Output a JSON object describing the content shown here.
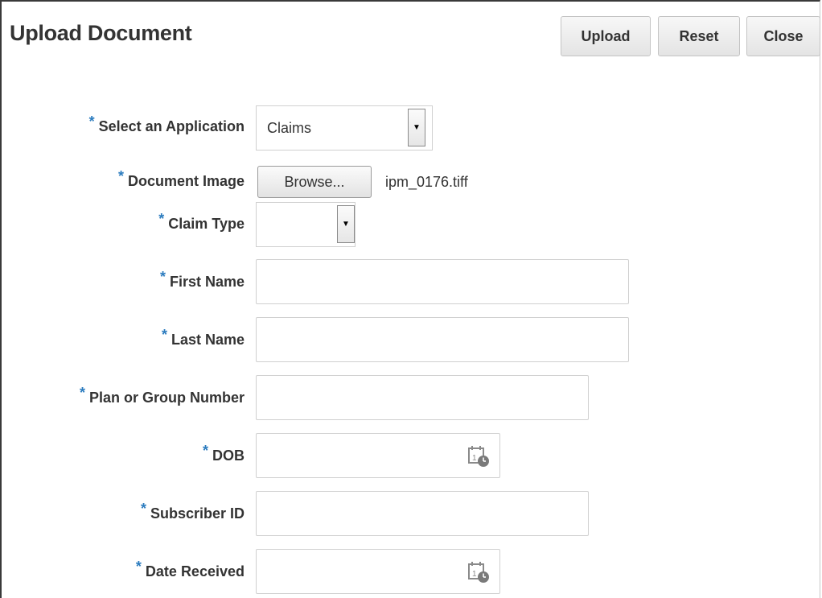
{
  "header": {
    "title": "Upload Document",
    "buttons": {
      "upload": "Upload",
      "reset": "Reset",
      "close": "Close"
    }
  },
  "form": {
    "required_marker": "*",
    "application": {
      "label": "Select an Application",
      "value": "Claims"
    },
    "document_image": {
      "label": "Document Image",
      "button": "Browse...",
      "filename": "ipm_0176.tiff"
    },
    "claim_type": {
      "label": "Claim Type",
      "value": ""
    },
    "first_name": {
      "label": "First Name",
      "value": ""
    },
    "last_name": {
      "label": "Last Name",
      "value": ""
    },
    "plan_group": {
      "label": "Plan or Group Number",
      "value": ""
    },
    "dob": {
      "label": "DOB",
      "value": ""
    },
    "subscriber_id": {
      "label": "Subscriber ID",
      "value": ""
    },
    "date_received": {
      "label": "Date Received",
      "value": ""
    }
  },
  "icons": {
    "calendar": "calendar-clock-icon",
    "dropdown": "chevron-down-icon"
  },
  "colors": {
    "required": "#2c7cbf",
    "text": "#333333"
  }
}
